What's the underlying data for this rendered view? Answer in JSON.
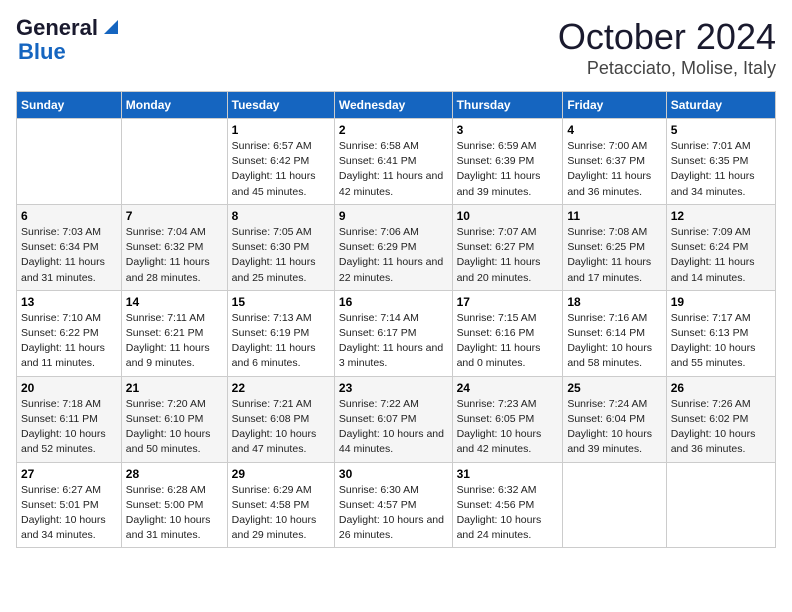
{
  "logo": {
    "line1": "General",
    "line2": "Blue"
  },
  "title": "October 2024",
  "subtitle": "Petacciato, Molise, Italy",
  "headers": [
    "Sunday",
    "Monday",
    "Tuesday",
    "Wednesday",
    "Thursday",
    "Friday",
    "Saturday"
  ],
  "weeks": [
    [
      {
        "day": "",
        "info": ""
      },
      {
        "day": "",
        "info": ""
      },
      {
        "day": "1",
        "info": "Sunrise: 6:57 AM\nSunset: 6:42 PM\nDaylight: 11 hours and 45 minutes."
      },
      {
        "day": "2",
        "info": "Sunrise: 6:58 AM\nSunset: 6:41 PM\nDaylight: 11 hours and 42 minutes."
      },
      {
        "day": "3",
        "info": "Sunrise: 6:59 AM\nSunset: 6:39 PM\nDaylight: 11 hours and 39 minutes."
      },
      {
        "day": "4",
        "info": "Sunrise: 7:00 AM\nSunset: 6:37 PM\nDaylight: 11 hours and 36 minutes."
      },
      {
        "day": "5",
        "info": "Sunrise: 7:01 AM\nSunset: 6:35 PM\nDaylight: 11 hours and 34 minutes."
      }
    ],
    [
      {
        "day": "6",
        "info": "Sunrise: 7:03 AM\nSunset: 6:34 PM\nDaylight: 11 hours and 31 minutes."
      },
      {
        "day": "7",
        "info": "Sunrise: 7:04 AM\nSunset: 6:32 PM\nDaylight: 11 hours and 28 minutes."
      },
      {
        "day": "8",
        "info": "Sunrise: 7:05 AM\nSunset: 6:30 PM\nDaylight: 11 hours and 25 minutes."
      },
      {
        "day": "9",
        "info": "Sunrise: 7:06 AM\nSunset: 6:29 PM\nDaylight: 11 hours and 22 minutes."
      },
      {
        "day": "10",
        "info": "Sunrise: 7:07 AM\nSunset: 6:27 PM\nDaylight: 11 hours and 20 minutes."
      },
      {
        "day": "11",
        "info": "Sunrise: 7:08 AM\nSunset: 6:25 PM\nDaylight: 11 hours and 17 minutes."
      },
      {
        "day": "12",
        "info": "Sunrise: 7:09 AM\nSunset: 6:24 PM\nDaylight: 11 hours and 14 minutes."
      }
    ],
    [
      {
        "day": "13",
        "info": "Sunrise: 7:10 AM\nSunset: 6:22 PM\nDaylight: 11 hours and 11 minutes."
      },
      {
        "day": "14",
        "info": "Sunrise: 7:11 AM\nSunset: 6:21 PM\nDaylight: 11 hours and 9 minutes."
      },
      {
        "day": "15",
        "info": "Sunrise: 7:13 AM\nSunset: 6:19 PM\nDaylight: 11 hours and 6 minutes."
      },
      {
        "day": "16",
        "info": "Sunrise: 7:14 AM\nSunset: 6:17 PM\nDaylight: 11 hours and 3 minutes."
      },
      {
        "day": "17",
        "info": "Sunrise: 7:15 AM\nSunset: 6:16 PM\nDaylight: 11 hours and 0 minutes."
      },
      {
        "day": "18",
        "info": "Sunrise: 7:16 AM\nSunset: 6:14 PM\nDaylight: 10 hours and 58 minutes."
      },
      {
        "day": "19",
        "info": "Sunrise: 7:17 AM\nSunset: 6:13 PM\nDaylight: 10 hours and 55 minutes."
      }
    ],
    [
      {
        "day": "20",
        "info": "Sunrise: 7:18 AM\nSunset: 6:11 PM\nDaylight: 10 hours and 52 minutes."
      },
      {
        "day": "21",
        "info": "Sunrise: 7:20 AM\nSunset: 6:10 PM\nDaylight: 10 hours and 50 minutes."
      },
      {
        "day": "22",
        "info": "Sunrise: 7:21 AM\nSunset: 6:08 PM\nDaylight: 10 hours and 47 minutes."
      },
      {
        "day": "23",
        "info": "Sunrise: 7:22 AM\nSunset: 6:07 PM\nDaylight: 10 hours and 44 minutes."
      },
      {
        "day": "24",
        "info": "Sunrise: 7:23 AM\nSunset: 6:05 PM\nDaylight: 10 hours and 42 minutes."
      },
      {
        "day": "25",
        "info": "Sunrise: 7:24 AM\nSunset: 6:04 PM\nDaylight: 10 hours and 39 minutes."
      },
      {
        "day": "26",
        "info": "Sunrise: 7:26 AM\nSunset: 6:02 PM\nDaylight: 10 hours and 36 minutes."
      }
    ],
    [
      {
        "day": "27",
        "info": "Sunrise: 6:27 AM\nSunset: 5:01 PM\nDaylight: 10 hours and 34 minutes."
      },
      {
        "day": "28",
        "info": "Sunrise: 6:28 AM\nSunset: 5:00 PM\nDaylight: 10 hours and 31 minutes."
      },
      {
        "day": "29",
        "info": "Sunrise: 6:29 AM\nSunset: 4:58 PM\nDaylight: 10 hours and 29 minutes."
      },
      {
        "day": "30",
        "info": "Sunrise: 6:30 AM\nSunset: 4:57 PM\nDaylight: 10 hours and 26 minutes."
      },
      {
        "day": "31",
        "info": "Sunrise: 6:32 AM\nSunset: 4:56 PM\nDaylight: 10 hours and 24 minutes."
      },
      {
        "day": "",
        "info": ""
      },
      {
        "day": "",
        "info": ""
      }
    ]
  ]
}
